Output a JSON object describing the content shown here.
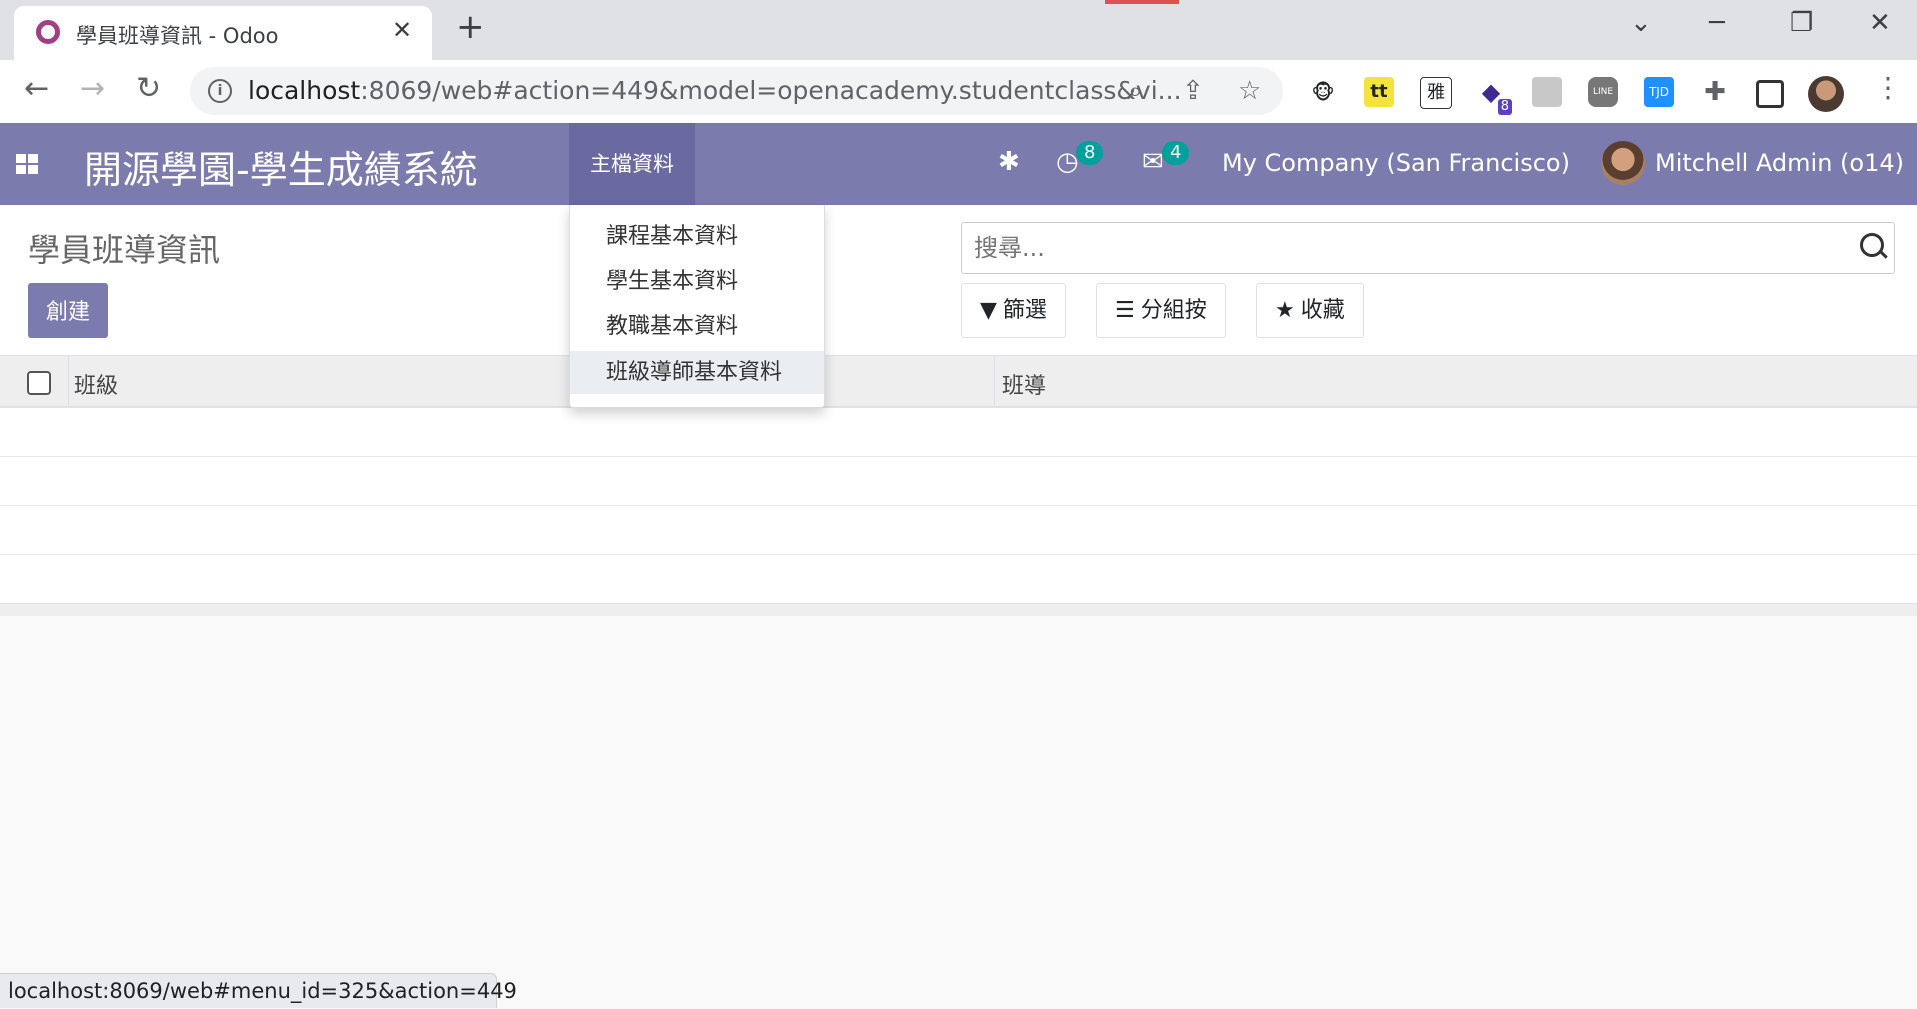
{
  "browser": {
    "tab_title": "學員班導資訊 - Odoo",
    "tab_close": "✕",
    "new_tab": "+",
    "url_host": "localhost",
    "url_rest": ":8069/web#action=449&model=openacademy.studentclass&vi...",
    "extensions": [
      "monkey-extension",
      "tt-extension",
      "雅",
      "diamond-extension",
      "book-extension",
      "LINE",
      "TJD",
      "puzzle-extension",
      "sidebar-extension"
    ],
    "ext_badge": "8"
  },
  "navbar": {
    "app_title": "開源學園-學生成績系統",
    "menu_main": "主檔資料",
    "activity_count": "8",
    "message_count": "4",
    "company": "My Company (San Francisco)",
    "user": "Mitchell Admin (o14)"
  },
  "control": {
    "breadcrumb": "學員班導資訊",
    "create": "創建",
    "search_placeholder": "搜尋...",
    "filter": "篩選",
    "group_by": "分組按",
    "favorites": "收藏"
  },
  "list": {
    "columns": [
      "班級",
      "班導"
    ],
    "empty_rows": 4
  },
  "dropdown": {
    "items": [
      "課程基本資料",
      "學生基本資料",
      "教職基本資料",
      "班級導師基本資料"
    ],
    "active_index": 3
  },
  "statusbar": {
    "text": "localhost:8069/web#menu_id=325&action=449"
  }
}
